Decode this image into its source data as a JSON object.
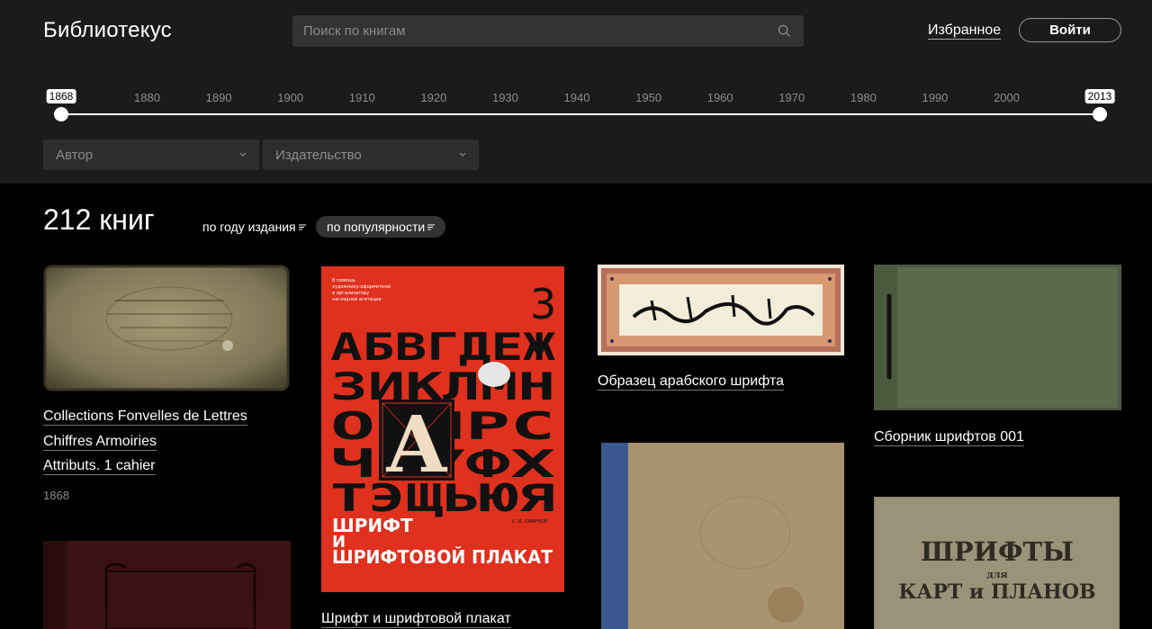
{
  "header": {
    "logo": "Библиотекус",
    "search_placeholder": "Поиск по книгам",
    "favorites": "Избранное",
    "login": "Войти"
  },
  "timeline": {
    "min_year": "1868",
    "max_year": "2013",
    "ticks": [
      "1880",
      "1890",
      "1900",
      "1910",
      "1920",
      "1930",
      "1940",
      "1950",
      "1960",
      "1970",
      "1980",
      "1990",
      "2000"
    ],
    "range": [
      1868,
      2013
    ]
  },
  "filters": {
    "author": "Автор",
    "publisher": "Издательство"
  },
  "results": {
    "count": "212 книг",
    "sort_year": "по году издания",
    "sort_popularity": "по популярности"
  },
  "books": [
    {
      "lines": [
        "Collections Fonvelles de Lettres",
        "Chiffres Armoiries",
        "Attributs. 1 cahier"
      ],
      "year": "1868"
    },
    {
      "title": "Шрифт и шрифтовой плакат",
      "cover_number": "3",
      "cover_letters": [
        "АБВГДЕЖ",
        "ЗИКЛМН",
        "О  ПРС",
        "Ч   УФХ",
        "ТЭЩЬЮЯ"
      ],
      "cover_big_letter": "А",
      "cover_title": [
        "ШРИФТ",
        "И",
        "ШРИФТОВОЙ ПЛАКАТ"
      ],
      "cover_author": "С. И. СМИРНОВ"
    },
    {
      "title": "Образец арабского шрифта"
    },
    {
      "title": "Сборник шрифтов 001"
    },
    {
      "cover_title": [
        "ШРИФТЫ",
        "для",
        "КАРТ и ПЛАНОВ"
      ]
    }
  ],
  "colors": {
    "panel_bg": "#1b1b1b",
    "page_bg": "#000000",
    "poster_red": "#e0301e"
  }
}
